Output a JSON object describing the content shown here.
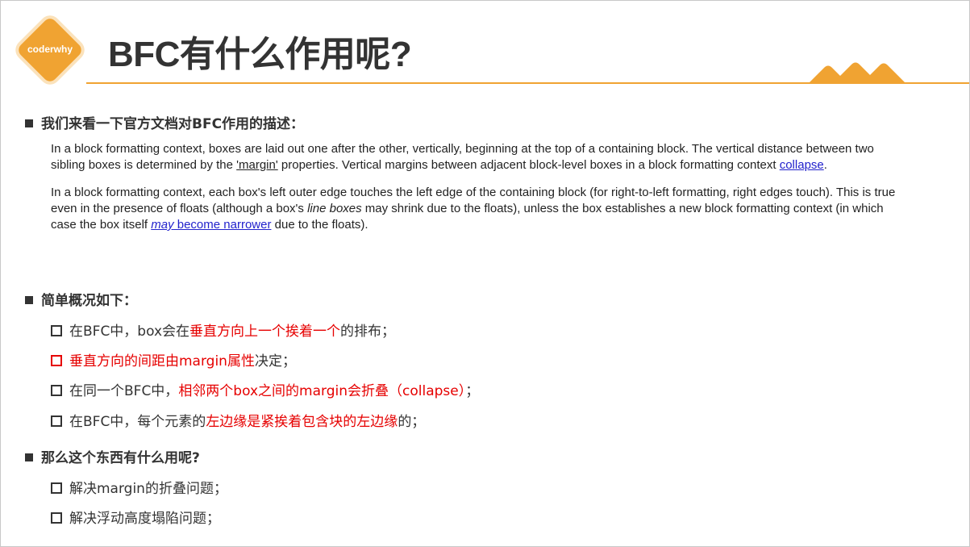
{
  "logo": {
    "text": "coderwhy"
  },
  "title": "BFC有什么作用呢?",
  "section1": {
    "heading": "我们来看一下官方文档对BFC作用的描述：",
    "p1": {
      "a": "In a block formatting context, boxes are laid out one after the other, vertically, beginning at the top of a containing block. The vertical distance between two sibling boxes is determined by the ",
      "margin": "'margin'",
      "b": " properties. Vertical margins between adjacent block-level boxes in a block formatting context ",
      "link": "collapse",
      "c": "."
    },
    "p2": {
      "a": "In a block formatting context, each box's left outer edge touches the left edge of the containing block (for right-to-left formatting, right edges touch). This is true even in the presence of floats (although a box's ",
      "italic": "line boxes",
      "b": " may shrink due to the floats), unless the box establishes a new block formatting context (in which case the box itself ",
      "link_may": "may",
      "link_rest": " become narrower",
      "c": " due to the floats)."
    }
  },
  "section2": {
    "heading": "简单概况如下：",
    "items": [
      {
        "a": "在BFC中，box会在",
        "red": "垂直方向上一个挨着一个",
        "b": "的排布；"
      },
      {
        "a": "",
        "red": "垂直方向的间距由margin属性",
        "b": "决定；"
      },
      {
        "a": "在同一个BFC中，",
        "red": "相邻两个box之间的margin会折叠（collapse）",
        "b": "；"
      },
      {
        "a": "在BFC中，每个元素的",
        "red": "左边缘是紧挨着包含块的左边缘",
        "b": "的；"
      }
    ]
  },
  "section3": {
    "heading": "那么这个东西有什么用呢?",
    "items": [
      "解决margin的折叠问题；",
      "解决浮动高度塌陷问题；"
    ]
  },
  "colors": {
    "accent": "#f0a332",
    "emphasis": "#e60000",
    "link": "#2222cc"
  }
}
